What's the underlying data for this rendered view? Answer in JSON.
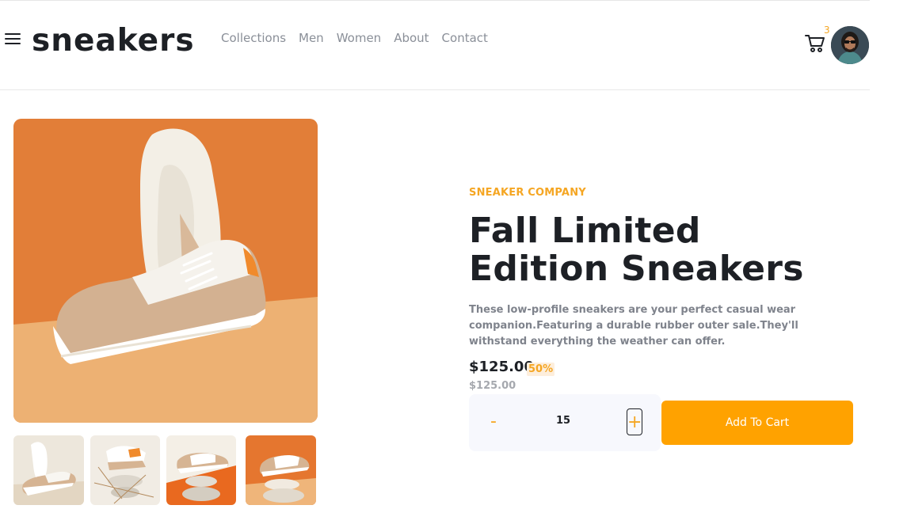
{
  "header": {
    "logo": "sneakers",
    "nav": [
      "Collections",
      "Men",
      "Women",
      "About",
      "Contact"
    ],
    "cart_count": "3"
  },
  "product": {
    "company": "SNEAKER COMPANY",
    "title": "Fall Limited Edition Sneakers",
    "description": "These low-profile sneakers are your perfect casual wear companion.Featuring a durable rubber outer sale.They'll withstand everything the weather can offer.",
    "price": "$125.00",
    "discount": "50%",
    "old_price": "$125.00"
  },
  "quantity": {
    "minus": "-",
    "value": "15",
    "plus": "+"
  },
  "actions": {
    "add_to_cart": "Add To Cart"
  },
  "colors": {
    "accent": "#ffa200",
    "accent_text": "#f5a623",
    "dark": "#1d2025",
    "muted": "#7f838c"
  },
  "icons": [
    "menu-icon",
    "cart-icon",
    "avatar"
  ]
}
